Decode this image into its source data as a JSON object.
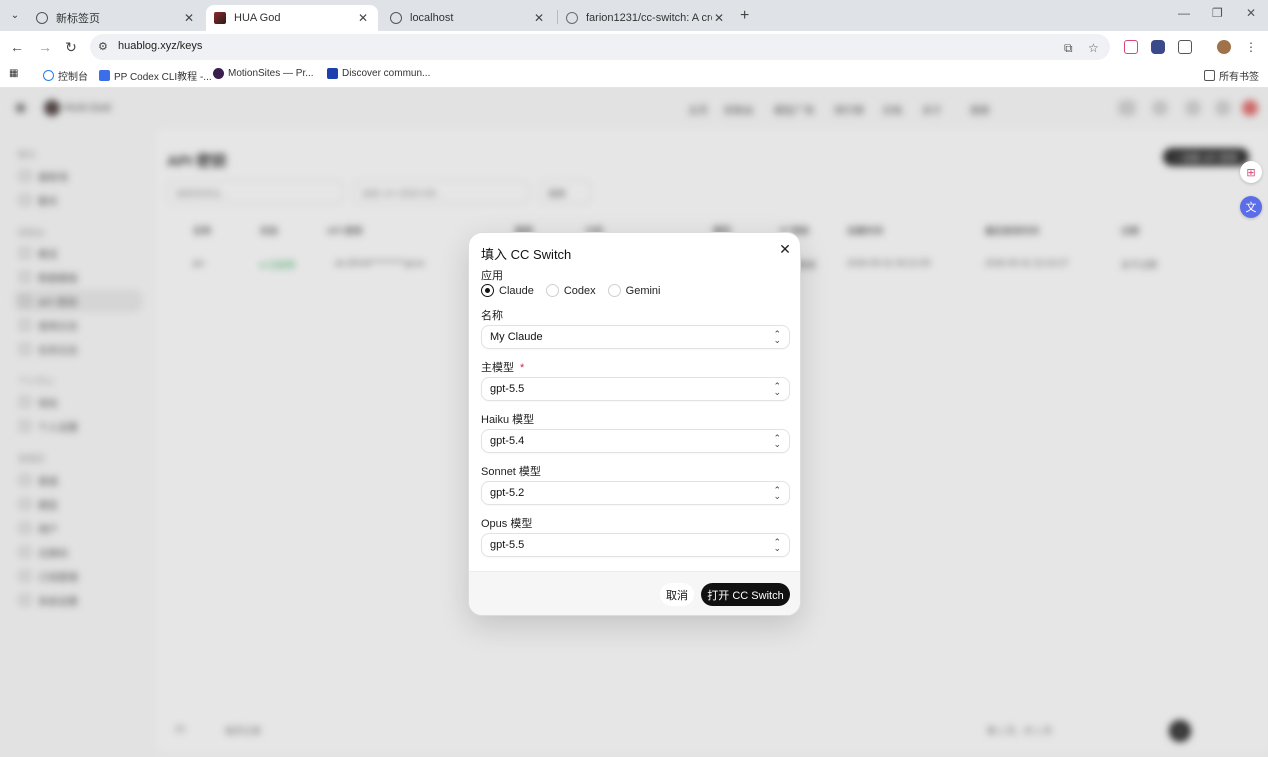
{
  "browser": {
    "tabs": [
      {
        "label": "新标签页",
        "active": false
      },
      {
        "label": "HUA God",
        "active": true
      },
      {
        "label": "localhost",
        "active": false
      },
      {
        "label": "farion1231/cc-switch: A cross",
        "active": false
      }
    ],
    "close_glyph": "✕",
    "newtab_glyph": "+",
    "url": "huablog.xyz/keys",
    "bookmarks": [
      {
        "label": "控制台",
        "icon": "cloud-icon",
        "color": "#2b7de9"
      },
      {
        "label": "PP Codex CLI教程 -...",
        "icon": "doc-icon",
        "color": "#3b6ee8"
      },
      {
        "label": "MotionSites — Pr...",
        "icon": "motion-icon",
        "color": "#3a1f4d"
      },
      {
        "label": "Discover commun...",
        "icon": "discover-icon",
        "color": "#1e40af"
      }
    ],
    "all_bookmarks_label": "所有书签"
  },
  "app": {
    "name": "HUA God",
    "page_title": "API 密钥",
    "create_label": "+ 创建 API 密钥",
    "nav": [
      "主页",
      "控制台",
      "模型广场",
      "排行榜",
      "文档",
      "关于",
      "搜索"
    ],
    "sidebar_groups": [
      "聊天",
      "控制台",
      "个人中心",
      "管理员"
    ],
    "sidebar_items": [
      "操练场",
      "聊天",
      "概览",
      "数据看板",
      "API 密钥",
      "使用日志",
      "任务日志",
      "钱包",
      "个人设置",
      "渠道",
      "模型",
      "用户",
      "兑换码",
      "订阅管理",
      "系统设置"
    ],
    "filters": [
      "搜索密钥名...",
      "搜索 API 密钥令牌...",
      "搜索"
    ],
    "table_headers": [
      "名称",
      "状态",
      "API 密钥",
      "额度",
      "分组",
      "模型",
      "IP 限制",
      "创建时间",
      "最后使用时间",
      "过期"
    ],
    "row": [
      "jav",
      "● 已启用",
      "sk-ZKHd**********gcuo",
      "无限额度",
      "2026-05-31 06:21:55",
      "2026-05-31 22:15:27",
      "永不过期"
    ],
    "pager_left": [
      "20",
      "每页记录"
    ],
    "pager_right": "第 1 页，共 1 页",
    "page_number": "1"
  },
  "modal": {
    "title": "填入 CC Switch",
    "close_glyph": "✕",
    "app_label": "应用",
    "app_options": [
      {
        "label": "Claude",
        "checked": true
      },
      {
        "label": "Codex",
        "checked": false
      },
      {
        "label": "Gemini",
        "checked": false
      }
    ],
    "name_label": "名称",
    "name_value": "My Claude",
    "main_model_label": "主模型",
    "required_mark": "*",
    "main_model_value": "gpt-5.5",
    "haiku_label": "Haiku 模型",
    "haiku_value": "gpt-5.4",
    "sonnet_label": "Sonnet 模型",
    "sonnet_value": "gpt-5.2",
    "opus_label": "Opus 模型",
    "opus_value": "gpt-5.5",
    "cancel_label": "取消",
    "open_label": "打开 CC Switch"
  }
}
